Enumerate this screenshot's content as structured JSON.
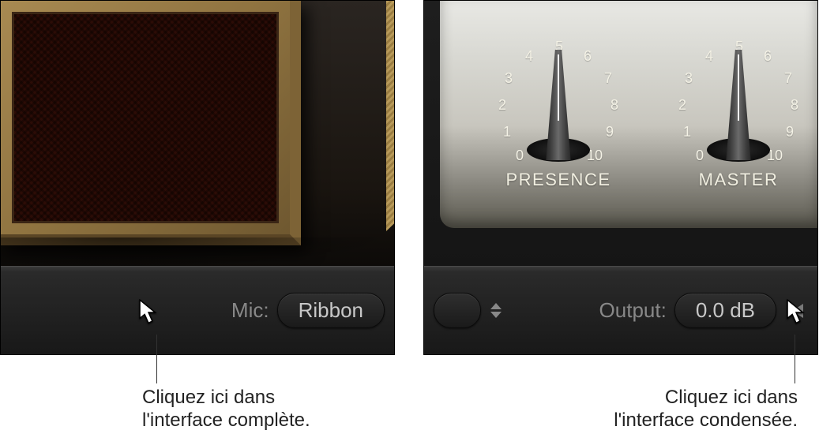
{
  "left": {
    "mic_label": "Mic:",
    "mic_value": "Ribbon"
  },
  "right": {
    "output_label": "Output:",
    "output_value": "0.0 dB",
    "knobs": [
      {
        "label": "PRESENCE",
        "ticks": [
          "0",
          "1",
          "2",
          "3",
          "4",
          "5",
          "6",
          "7",
          "8",
          "9",
          "10"
        ]
      },
      {
        "label": "MASTER",
        "ticks": [
          "0",
          "1",
          "2",
          "3",
          "4",
          "5",
          "6",
          "7",
          "8",
          "9",
          "10"
        ]
      }
    ]
  },
  "callouts": {
    "left_line1": "Cliquez ici dans",
    "left_line2": "l'interface complète.",
    "right_line1": "Cliquez ici dans",
    "right_line2": "l'interface condensée."
  }
}
